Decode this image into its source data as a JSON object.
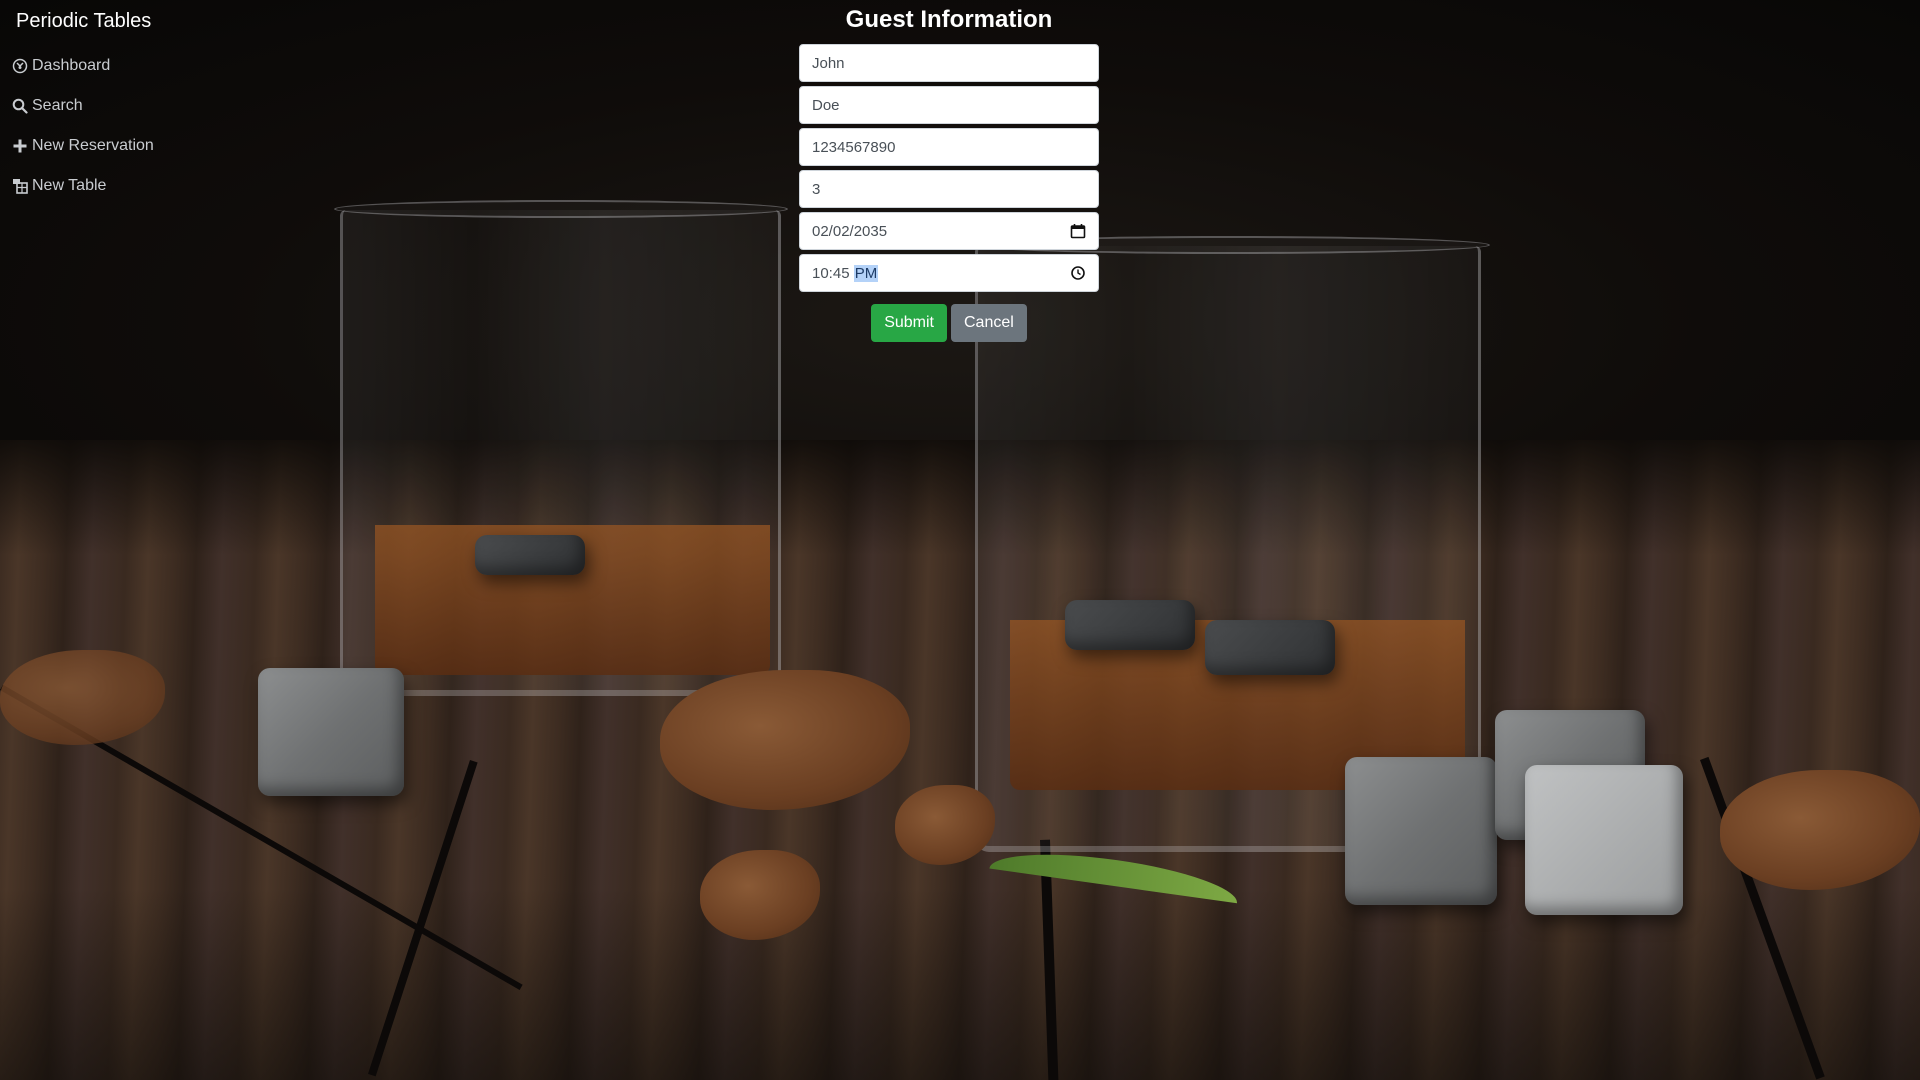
{
  "sidebar": {
    "brand": "Periodic Tables",
    "items": [
      {
        "label": "Dashboard",
        "icon": "dashboard-icon"
      },
      {
        "label": "Search",
        "icon": "search-icon"
      },
      {
        "label": "New Reservation",
        "icon": "plus-icon"
      },
      {
        "label": "New Table",
        "icon": "table-icon"
      }
    ]
  },
  "form": {
    "title": "Guest Information",
    "first_name": "John",
    "last_name": "Doe",
    "mobile_number": "1234567890",
    "people": "3",
    "date": "02/02/2035",
    "time_value": "10:45",
    "time_period": "PM",
    "submit_label": "Submit",
    "cancel_label": "Cancel"
  },
  "colors": {
    "submit": "#28a745",
    "cancel": "#6c757d",
    "text_light": "#ffffff"
  }
}
